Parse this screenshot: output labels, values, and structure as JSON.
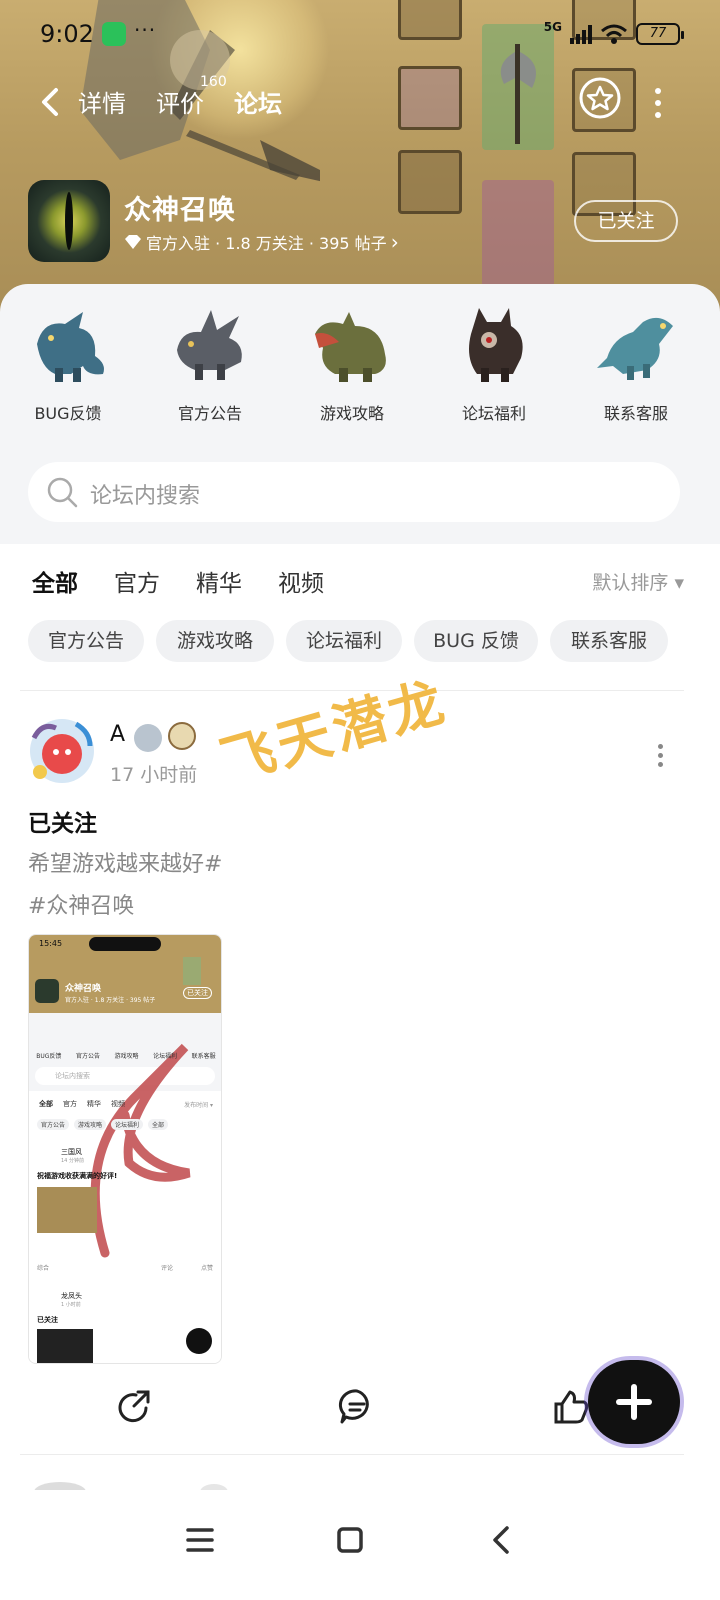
{
  "status_bar": {
    "time": "9:02",
    "dots": "···",
    "network": "5G",
    "battery": "77"
  },
  "nav": {
    "tabs": [
      {
        "label": "详情"
      },
      {
        "label": "评价"
      },
      {
        "label": "论坛"
      }
    ],
    "review_count": "160",
    "active_tab": "论坛"
  },
  "game": {
    "name": "众神召唤",
    "meta": "官方入驻 · 1.8 万关注 · 395 帖子",
    "meta_chevron": "›",
    "follow_label": "已关注"
  },
  "shortcuts": [
    {
      "label": "BUG反馈",
      "color": "#3f6f86"
    },
    {
      "label": "官方公告",
      "color": "#5a5e66"
    },
    {
      "label": "游戏攻略",
      "color": "#6b6f3d"
    },
    {
      "label": "论坛福利",
      "color": "#3a2e2a"
    },
    {
      "label": "联系客服",
      "color": "#4f8f9e"
    }
  ],
  "search": {
    "placeholder": "论坛内搜索"
  },
  "filter_tabs": [
    "全部",
    "官方",
    "精华",
    "视频"
  ],
  "sort_label": "默认排序 ▾",
  "chips": [
    "官方公告",
    "游戏攻略",
    "论坛福利",
    "BUG 反馈",
    "联系客服"
  ],
  "post": {
    "author": "A",
    "time": "17 小时前",
    "title": "已关注",
    "body_line1": "希望游戏越来越好#",
    "body_line2": "#众神召唤",
    "watermark": "飞天潜龙",
    "thumbnail": {
      "status_time": "15:45",
      "game_name": "众神召唤",
      "game_meta": "官方入驻 · 1.8 万关注 · 395 帖子",
      "follow_label": "已关注",
      "shortcuts": [
        "BUG反馈",
        "官方公告",
        "游戏攻略",
        "论坛福利",
        "联系客服"
      ],
      "search_placeholder": "论坛内搜索",
      "tabs": [
        "全部",
        "官方",
        "精华",
        "视频"
      ],
      "sort_label": "发布时间 ▾",
      "chips": [
        "官方公告",
        "游戏攻略",
        "论坛福利",
        "全部"
      ],
      "post1_author": "三国风",
      "post1_time": "14 分钟前",
      "post1_title": "祝福游戏收获满满的好评!",
      "post1_tag": "综合",
      "post1_comment": "评论",
      "post1_like": "点赞",
      "post2_author": "龙凤头",
      "post2_time": "1 小时前",
      "post2_title": "已关注"
    }
  },
  "colors": {
    "accent": "#3ee0c0",
    "banner": "#b79b60",
    "watermark": "#f0b53a"
  }
}
